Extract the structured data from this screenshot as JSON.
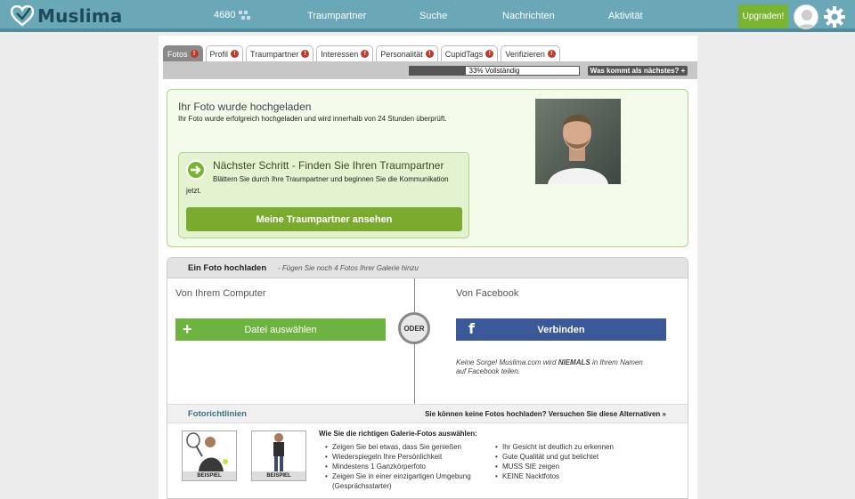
{
  "header": {
    "logo_text": "Muslima",
    "counter": "4680",
    "nav": [
      "Traumpartner",
      "Suche",
      "Nachrichten",
      "Aktivität"
    ],
    "upgrade_label": "Upgraden!"
  },
  "tabs": [
    {
      "label": "Fotos",
      "badge": "!",
      "active": true
    },
    {
      "label": "Profil",
      "badge": "!"
    },
    {
      "label": "Traumpartner",
      "badge": "!"
    },
    {
      "label": "Interessen",
      "badge": "!"
    },
    {
      "label": "Personalität",
      "badge": "!"
    },
    {
      "label": "CupidTags",
      "badge": "!"
    },
    {
      "label": "Verifizieren",
      "badge": "!"
    }
  ],
  "progress": {
    "percent": 33,
    "label": "33% Vollständig",
    "next_label": "Was kommt als nächstes? +"
  },
  "upload_ok": {
    "title": "Ihr Foto wurde hochgeladen",
    "text": "Ihr Foto wurde erfolgreich hochgeladen und wird innerhalb von 24 Stunden überprüft.",
    "next_title": "Nächster Schritt - Finden Sie Ihren Traumpartner",
    "next_text": "Blättern Sie durch Ihre Traumpartner und beginnen Sie die Kommunikation jetzt.",
    "cta": "Meine Traumpartner ansehen"
  },
  "upload": {
    "title": "Ein Foto hochladen",
    "subtitle": "- Fügen Sie noch 4 Fotos Ihrer Galerie hinzu",
    "computer_title": "Von Ihrem Computer",
    "facebook_title": "Von Facebook",
    "file_button": "Datei auswählen",
    "or": "ODER",
    "fb_button": "Verbinden",
    "fb_note_pre": "Keine Sorge! Muslima.com wird ",
    "fb_note_bold": "NIEMALS",
    "fb_note_post": " in Ihrem Namen auf Facebook teilen."
  },
  "guidelines": {
    "title": "Fotorichtlinien",
    "alternatives": "Sie können keine Fotos hochladen? Versuchen Sie diese Alternativen »",
    "example_label": "BEISPIEL",
    "tips_title": "Wie Sie die richtigen Galerie-Fotos auswählen:",
    "tips_left": [
      "Zeigen Sie bei etwas, dass Sie genießen",
      "Wiederspiegeln Ihre Persönlichkeit",
      "Mindestens 1 Ganzkörperfoto",
      "Zeigen Sie in einer einzigartigen Umgebung (Gesprächsstarter)"
    ],
    "tips_right": [
      "Ihr Gesicht ist deutlich zu erkennen",
      "Gute Qualität und gut belichtet",
      "MUSS SIE zeigen",
      "KEINE Nacktfotos"
    ]
  },
  "colors": {
    "brand": "#6aa8b7",
    "green": "#7ab532",
    "facebook": "#3b5998"
  }
}
